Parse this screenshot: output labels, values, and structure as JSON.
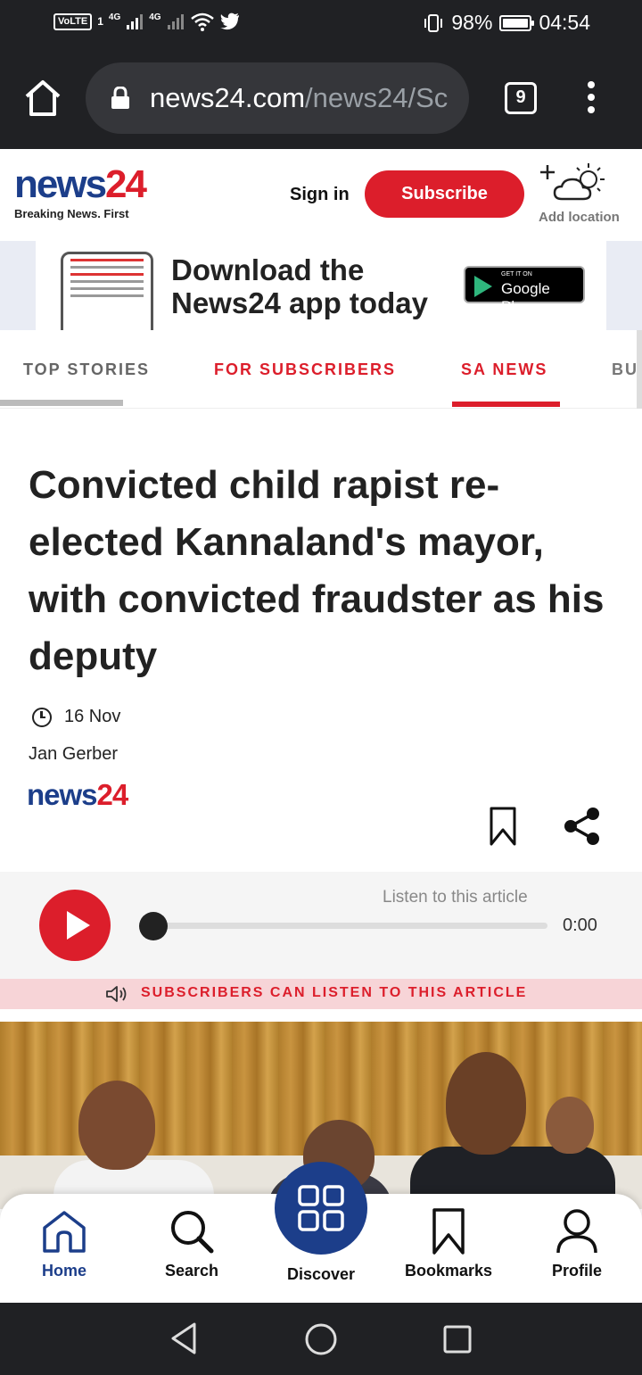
{
  "status_bar": {
    "left_indicators": [
      "VoLTE",
      "1",
      "4G",
      "4G"
    ],
    "battery": "98%",
    "battery_level": 0.98,
    "time": "04:54"
  },
  "browser": {
    "url_domain": "news24.com",
    "url_path": "/news24/Sc",
    "tab_count": "9"
  },
  "site_header": {
    "logo_news": "news",
    "logo_24": "24",
    "tagline": "Breaking News. First",
    "sign_in": "Sign in",
    "subscribe": "Subscribe",
    "add_location": "Add location"
  },
  "app_banner": {
    "line1": "Download the",
    "line2": "News24 app today",
    "store_small": "GET IT ON",
    "store_name": "Google Play"
  },
  "tabs": [
    {
      "label": "TOP STORIES"
    },
    {
      "label": "FOR SUBSCRIBERS"
    },
    {
      "label": "SA NEWS"
    },
    {
      "label": "BU"
    }
  ],
  "article": {
    "headline": "Convicted child rapist re-elected Kannaland's mayor, with convicted fraudster as his deputy",
    "date": "16 Nov",
    "author": "Jan Gerber",
    "source_news": "news",
    "source_24": "24"
  },
  "audio": {
    "label": "Listen to this article",
    "time": "0:00",
    "progress": 0,
    "subscribers_notice": "SUBSCRIBERS CAN LISTEN TO THIS ARTICLE"
  },
  "bottom_nav": {
    "items": [
      {
        "label": "Home",
        "icon": "home-icon"
      },
      {
        "label": "Search",
        "icon": "search-icon"
      },
      {
        "label": "Discover",
        "icon": "grid-icon"
      },
      {
        "label": "Bookmarks",
        "icon": "bookmark-icon"
      },
      {
        "label": "Profile",
        "icon": "profile-icon"
      }
    ]
  },
  "colors": {
    "brand_blue": "#1c3e8a",
    "brand_red": "#dc1e2b",
    "chrome_dark": "#202124"
  }
}
